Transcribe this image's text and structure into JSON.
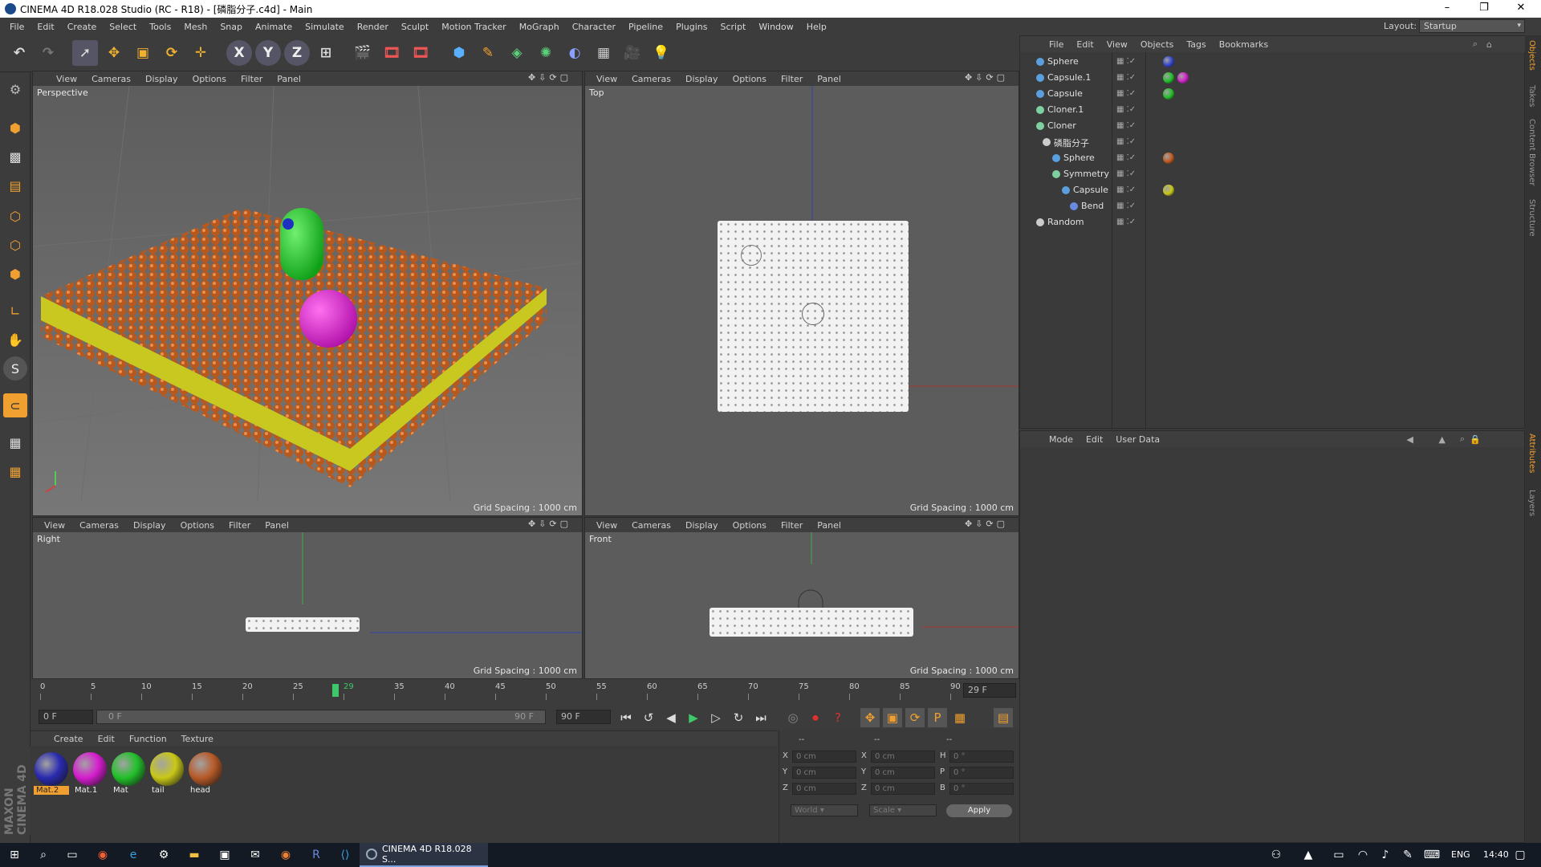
{
  "window": {
    "title": "CINEMA 4D R18.028 Studio (RC - R18) - [磷脂分子.c4d] - Main",
    "minimize": "–",
    "maximize": "❐",
    "close": "✕"
  },
  "menubar": [
    "File",
    "Edit",
    "Create",
    "Select",
    "Tools",
    "Mesh",
    "Snap",
    "Animate",
    "Simulate",
    "Render",
    "Sculpt",
    "Motion Tracker",
    "MoGraph",
    "Character",
    "Pipeline",
    "Plugins",
    "Script",
    "Window",
    "Help"
  ],
  "layout": {
    "label": "Layout:",
    "value": "Startup"
  },
  "toolbar": {
    "x_label": "X",
    "y_label": "Y",
    "z_label": "Z"
  },
  "viewports": {
    "menu": [
      "View",
      "Cameras",
      "Display",
      "Options",
      "Filter",
      "Panel"
    ],
    "perspective": {
      "name": "Perspective",
      "grid": "Grid Spacing : 1000 cm"
    },
    "top": {
      "name": "Top",
      "grid": "Grid Spacing : 1000 cm"
    },
    "right": {
      "name": "Right",
      "grid": "Grid Spacing : 1000 cm"
    },
    "front": {
      "name": "Front",
      "grid": "Grid Spacing : 1000 cm"
    }
  },
  "object_manager": {
    "menu": [
      "File",
      "Edit",
      "View",
      "Objects",
      "Tags",
      "Bookmarks"
    ],
    "objects": [
      {
        "name": "Sphere",
        "icon_color": "#5aa0e0",
        "tags": [
          "#3344cc"
        ]
      },
      {
        "name": "Capsule.1",
        "icon_color": "#5aa0e0",
        "tags": [
          "#22c02a",
          "#d020c8"
        ]
      },
      {
        "name": "Capsule",
        "icon_color": "#5aa0e0",
        "tags": [
          "#22c02a"
        ]
      },
      {
        "name": "Cloner.1",
        "icon_color": "#7fd0a0",
        "tags": []
      },
      {
        "name": "Cloner",
        "icon_color": "#7fd0a0",
        "tags": []
      },
      {
        "name": "磷脂分子",
        "icon_color": "#cccccc",
        "tags": []
      },
      {
        "name": "Sphere",
        "icon_color": "#5aa0e0",
        "tags": [
          "#c05a20"
        ]
      },
      {
        "name": "Symmetry",
        "icon_color": "#7fd0a0",
        "tags": []
      },
      {
        "name": "Capsule",
        "icon_color": "#5aa0e0",
        "tags": [
          "#c8c818"
        ]
      },
      {
        "name": "Bend",
        "icon_color": "#6a8ae0",
        "tags": []
      },
      {
        "name": "Random",
        "icon_color": "#cccccc",
        "tags": []
      }
    ]
  },
  "attribute_manager": {
    "menu": [
      "Mode",
      "Edit",
      "User Data"
    ]
  },
  "side_tabs": [
    "Objects",
    "Takes",
    "Content Browser",
    "Structure",
    "Attributes",
    "Layers"
  ],
  "timeline": {
    "ticks": [
      "0",
      "5",
      "10",
      "15",
      "20",
      "25",
      "29",
      "35",
      "40",
      "45",
      "50",
      "55",
      "60",
      "65",
      "70",
      "75",
      "80",
      "85",
      "90"
    ],
    "current_frame": "29 F",
    "start_field": "0 F",
    "range_start": "0 F",
    "range_end": "90 F",
    "end_field": "90 F"
  },
  "material_manager": {
    "menu": [
      "Create",
      "Edit",
      "Function",
      "Texture"
    ],
    "materials": [
      {
        "name": "Mat.2",
        "color": "#2a2ab0",
        "selected": true
      },
      {
        "name": "Mat.1",
        "color": "#d61ccf",
        "selected": false
      },
      {
        "name": "Mat",
        "color": "#22c02a",
        "selected": false
      },
      {
        "name": "tail",
        "color": "#c8c818",
        "selected": false
      },
      {
        "name": "head",
        "color": "#b85a28",
        "selected": false
      }
    ]
  },
  "coordinates": {
    "headers": [
      "--",
      "--",
      "--"
    ],
    "rows": [
      {
        "a": "X",
        "av": "0 cm",
        "b": "X",
        "bv": "0 cm",
        "c": "H",
        "cv": "0 °"
      },
      {
        "a": "Y",
        "av": "0 cm",
        "b": "Y",
        "bv": "0 cm",
        "c": "P",
        "cv": "0 °"
      },
      {
        "a": "Z",
        "av": "0 cm",
        "b": "Z",
        "bv": "0 cm",
        "c": "B",
        "cv": "0 °"
      }
    ],
    "mode": "World",
    "scale": "Scale",
    "apply": "Apply"
  },
  "branding": {
    "text": "MAXON CINEMA 4D"
  },
  "taskbar": {
    "app": "CINEMA 4D R18.028 S...",
    "lang": "ENG",
    "time": "14:40"
  }
}
